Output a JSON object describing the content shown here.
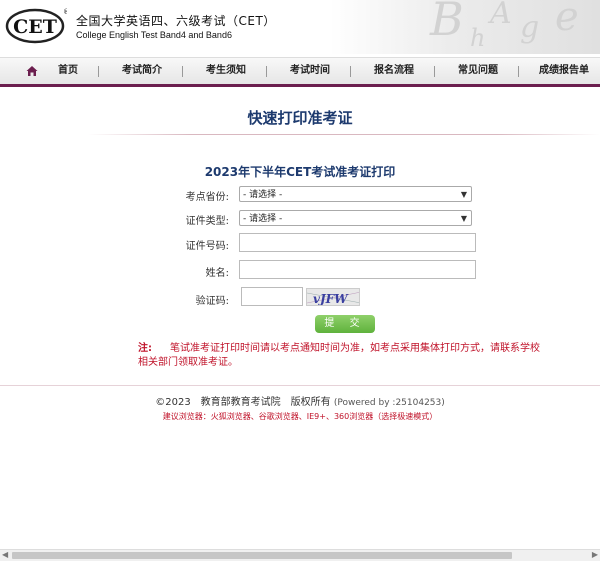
{
  "header": {
    "logo_text": "CET",
    "registered_mark": "®",
    "title_zh": "全国大学英语四、六级考试（CET）",
    "title_en": "College English Test Band4 and Band6"
  },
  "nav": {
    "home": "首页",
    "items": [
      "考试简介",
      "考生须知",
      "考试时间",
      "报名流程",
      "常见问题",
      "成绩报告单"
    ]
  },
  "page": {
    "title": "快速打印准考证",
    "form_title": "2023年下半年CET考试准考证打印"
  },
  "form": {
    "province_label": "考点省份:",
    "province_value": "- 请选择 -",
    "id_type_label": "证件类型:",
    "id_type_value": "- 请选择 -",
    "id_number_label": "证件号码:",
    "name_label": "姓名:",
    "captcha_label": "验证码:",
    "captcha_text": "vJFW",
    "submit_label": "提 交"
  },
  "note": {
    "heading": "注:",
    "text": "笔试准考证打印时间请以考点通知时间为准，如考点采用集体打印方式，请联系学校相关部门领取准考证。"
  },
  "footer": {
    "copyright": "©2023　教育部教育考试院　版权所有",
    "powered": "(Powered by :25104253)",
    "browsers": "建议浏览器：火狐浏览器、谷歌浏览器、IE9+、360浏览器（选择极速模式）"
  },
  "colors": {
    "nav_accent": "#6b1e4e",
    "title_blue": "#1d3a6e",
    "note_red": "#c0132a",
    "submit_green": "#6cbf45"
  }
}
